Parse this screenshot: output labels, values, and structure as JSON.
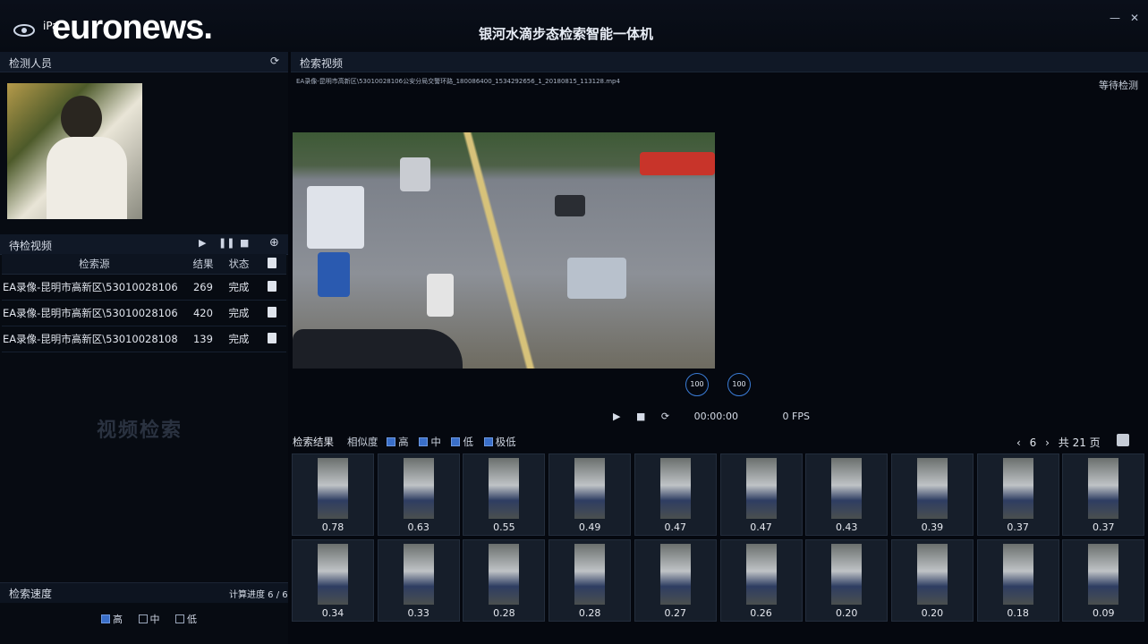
{
  "header": {
    "app_title": "银河水滴步态检索智能一体机",
    "mini_label": "iPa",
    "watermark": "euronews."
  },
  "left": {
    "detect_title": "检测人员",
    "pending_title": "待检视频",
    "columns": [
      "检索源",
      "结果",
      "状态"
    ],
    "rows": [
      {
        "source": "EA录像-昆明市高新区\\53010028106",
        "count": "269",
        "status": "完成"
      },
      {
        "source": "EA录像-昆明市高新区\\53010028106",
        "count": "420",
        "status": "完成"
      },
      {
        "source": "EA录像-昆明市高新区\\53010028108",
        "count": "139",
        "status": "完成"
      }
    ],
    "empty_label": "视频检索",
    "speed_title": "检索速度",
    "speed_progress": "计算进度 6 / 6",
    "speed_options": [
      {
        "label": "高",
        "checked": true
      },
      {
        "label": "中",
        "checked": false
      },
      {
        "label": "低",
        "checked": false
      }
    ]
  },
  "video": {
    "title": "检索视频",
    "path": "EA录像-昆明市高新区\\53010028106公安分局交警环路_180086400_1534292656_1_20180815_113128.mp4",
    "status": "等待检测",
    "ctl_a": "100",
    "ctl_b": "100",
    "time": "00:00:00",
    "fps": "0 FPS"
  },
  "results": {
    "title": "检索结果",
    "similarity_label": "相似度",
    "levels": [
      "高",
      "中",
      "低",
      "极低"
    ],
    "page_current": "6",
    "page_total": "共 21 页",
    "scores_row1": [
      "0.78",
      "0.63",
      "0.55",
      "0.49",
      "0.47",
      "0.47",
      "0.43",
      "0.39",
      "0.37",
      "0.37"
    ],
    "scores_row2": [
      "0.34",
      "0.33",
      "0.28",
      "0.28",
      "0.27",
      "0.26",
      "0.20",
      "0.20",
      "0.18",
      "0.09"
    ]
  }
}
